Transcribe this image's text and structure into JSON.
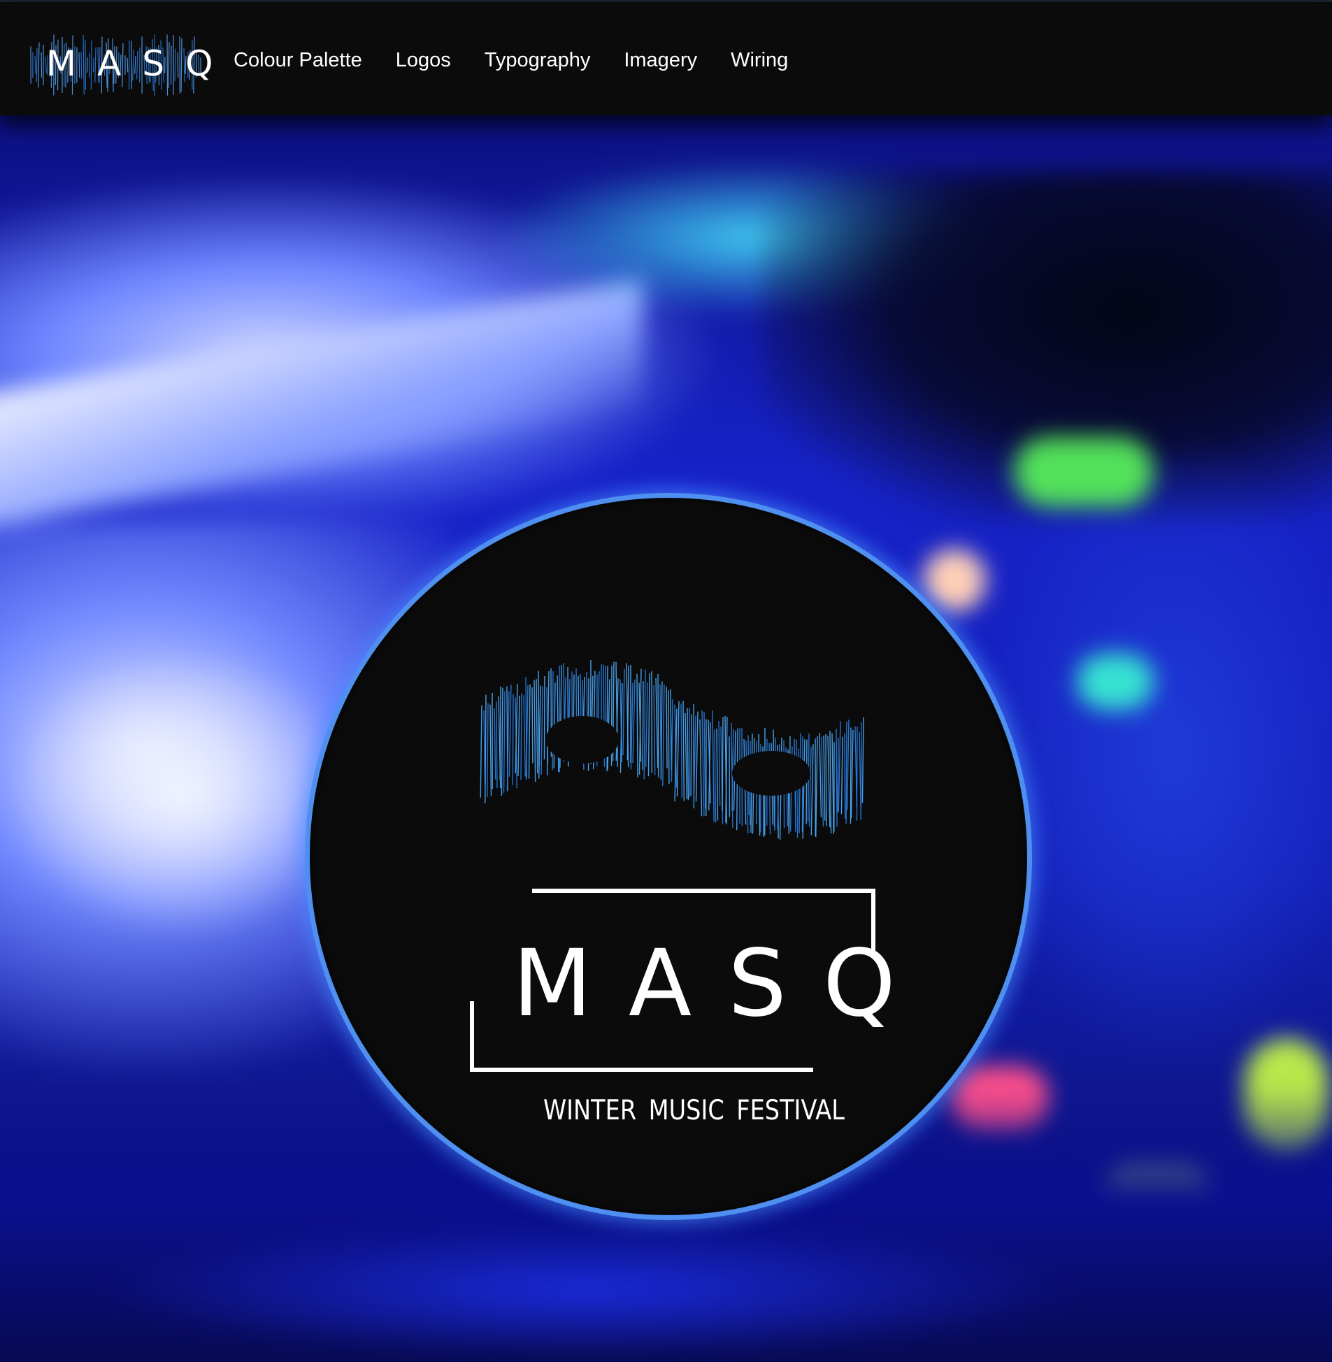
{
  "brand": {
    "logo_text": "MASQ"
  },
  "nav": {
    "links": [
      {
        "label": "Colour Palette"
      },
      {
        "label": "Logos"
      },
      {
        "label": "Typography"
      },
      {
        "label": "Imagery"
      },
      {
        "label": "Wiring"
      }
    ]
  },
  "hero": {
    "emblem": {
      "title": "MASQ",
      "subtitle": "WINTER MUSIC FESTIVAL",
      "mask_icon": "sound-wave-mask-icon"
    }
  },
  "colors": {
    "nav_background": "#0b0b0b",
    "emblem_background": "#0b0b0b",
    "emblem_ring": "#4e8ff0",
    "text": "#ffffff",
    "accent_blue": "#2a7fe6",
    "hero_blue": "#1426e0"
  }
}
